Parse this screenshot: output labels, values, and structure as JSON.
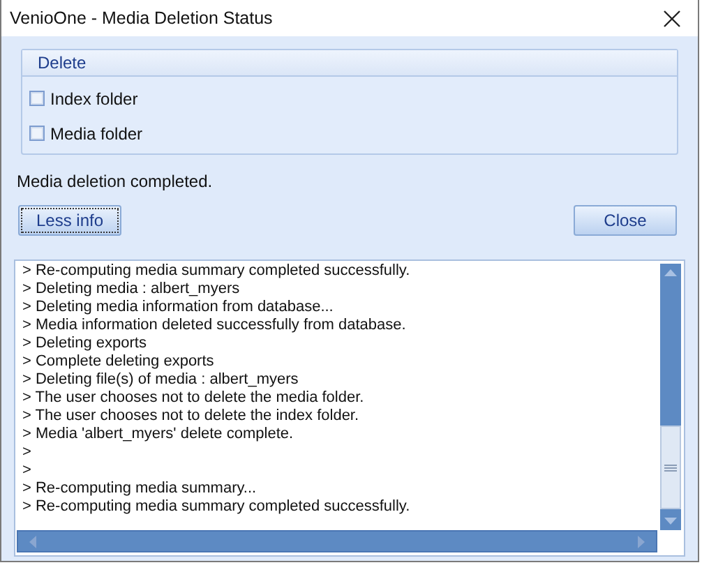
{
  "window": {
    "title": "VenioOne - Media Deletion Status"
  },
  "delete_group": {
    "title": "Delete",
    "options": [
      {
        "label": "Index folder",
        "checked": false
      },
      {
        "label": "Media folder",
        "checked": false
      }
    ]
  },
  "status_message": "Media deletion completed.",
  "buttons": {
    "less_info": "Less info",
    "close": "Close"
  },
  "log": [
    "> Re-computing media summary completed successfully.",
    "> Deleting media : albert_myers",
    "> Deleting media information from database...",
    "> Media information deleted successfully from database.",
    "> Deleting exports",
    "> Complete deleting exports",
    "> Deleting file(s) of media : albert_myers",
    "> The user chooses not to delete the media folder.",
    "> The user chooses not to delete the index folder.",
    "> Media 'albert_myers' delete complete.",
    ">",
    ">",
    "> Re-computing media summary...",
    "> Re-computing media summary completed successfully."
  ]
}
